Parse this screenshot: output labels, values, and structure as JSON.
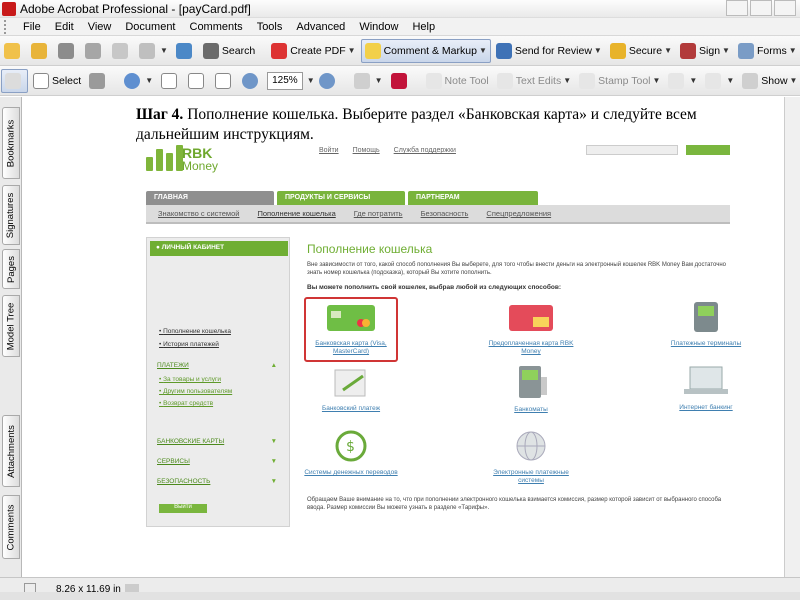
{
  "window": {
    "title": "Adobe Acrobat Professional - [payCard.pdf]"
  },
  "menu": [
    "File",
    "Edit",
    "View",
    "Document",
    "Comments",
    "Tools",
    "Advanced",
    "Window",
    "Help"
  ],
  "toolbar1": {
    "search": "Search",
    "create_pdf": "Create PDF",
    "comment_markup": "Comment & Markup",
    "send_review": "Send for Review",
    "secure": "Secure",
    "sign": "Sign",
    "forms": "Forms"
  },
  "toolbar2": {
    "select": "Select",
    "zoom": "125%",
    "note_tool": "Note Tool",
    "text_edits": "Text Edits",
    "stamp_tool": "Stamp Tool",
    "show": "Show"
  },
  "sidetabs": [
    "Bookmarks",
    "Signatures",
    "Pages",
    "Model Tree",
    "Attachments",
    "Comments"
  ],
  "document": {
    "heading_bold": "Шаг 4.",
    "heading_rest": " Пополнение кошелька. Выберите раздел «Банковская карта» и следуйте всем дальнейшим инструкциям.",
    "site": {
      "logo_line1": "RBK",
      "logo_line2": "Money",
      "top_links": [
        "Войти",
        "Помощь",
        "Служба поддержки"
      ],
      "nav_main": "ГЛАВНАЯ",
      "nav_products": "ПРОДУКТЫ И СЕРВИСЫ",
      "nav_partners": "ПАРТНЕРАМ",
      "subnav": [
        "Знакомство с системой",
        "Пополнение кошелька",
        "Где потратить",
        "Безопасность",
        "Спецпредложения"
      ],
      "cabinet": "ЛИЧНЫЙ КАБИНЕТ",
      "left_links": [
        "Пополнение кошелька",
        "История платежей"
      ],
      "payments_head": "ПЛАТЕЖИ",
      "payments_links": [
        "За товары и услуги",
        "Другим пользователям",
        "Возврат средств"
      ],
      "sections": [
        "БАНКОВСКИЕ КАРТЫ",
        "СЕРВИСЫ",
        "БЕЗОПАСНОСТЬ"
      ],
      "exit": "Выйти",
      "title": "Пополнение кошелька",
      "desc": "Вне зависимости от того, какой способ пополнения Вы выберете, для того чтобы внести деньги на электронный кошелек RBK Money Вам достаточно знать номер кошелька (подсказка), который Вы хотите пополнить.",
      "choose": "Вы можете пополнить свой кошелек, выбрав любой из следующих способов:",
      "options": [
        "Банковская карта (Visa, MasterCard)",
        "Предоплаченная карта RBK Money",
        "Платежные терминалы",
        "Банковский платеж",
        "Банкоматы",
        "Интернет банкинг",
        "Системы денежных переводов",
        "Электронные платежные системы"
      ],
      "footnote": "Обращаем Ваше внимание на то, что при пополнении электронного кошелька взимается комиссия, размер которой зависит от выбранного способа ввода. Размер комиссии Вы можете узнать в разделе «Тарифы»."
    }
  },
  "status": {
    "page_size": "8,26 x 11,69 in"
  }
}
